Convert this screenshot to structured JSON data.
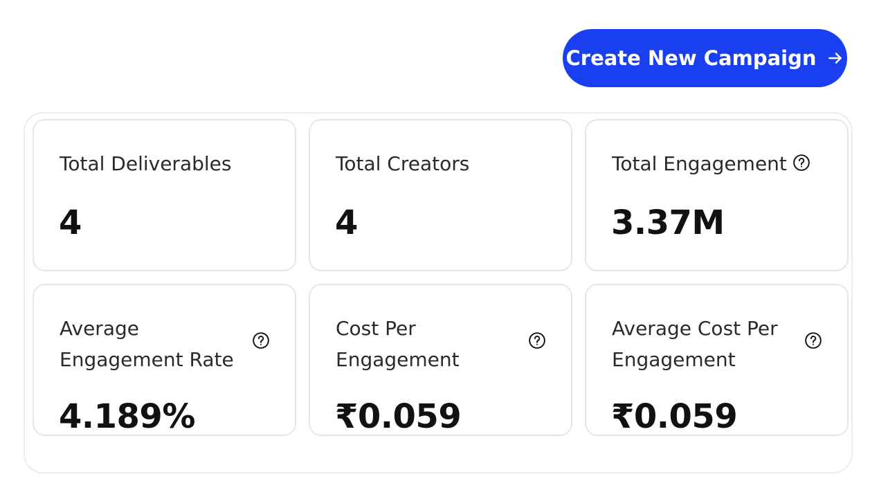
{
  "cta": {
    "label": "Create New Campaign",
    "icon": "arrow-right-icon",
    "color": "#1a3ff0"
  },
  "stats": [
    {
      "label": "Total Deliverables",
      "value": "4",
      "help": false
    },
    {
      "label": "Total Creators",
      "value": "4",
      "help": false
    },
    {
      "label": "Total Engagement",
      "value": "3.37M",
      "help": true
    },
    {
      "label": "Average Engagement Rate",
      "value": "4.189%",
      "help": true
    },
    {
      "label": "Cost Per Engagement",
      "value": "₹0.059",
      "help": true
    },
    {
      "label": "Average Cost Per Engagement",
      "value": "₹0.059",
      "help": true
    }
  ]
}
